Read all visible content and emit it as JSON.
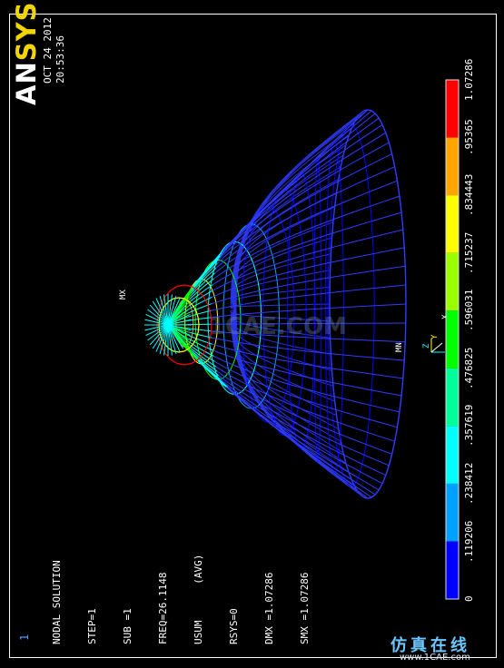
{
  "window": {
    "view_number": "1"
  },
  "logo": {
    "part1": "AN",
    "part2": "SYS"
  },
  "date": "OCT 24 2012",
  "time": "20:53:36",
  "solution_info": [
    "NODAL SOLUTION",
    "STEP=1",
    "SUB =1",
    "FREQ=26.1148",
    "USUM      (AVG)",
    "RSYS=0",
    "DMX =1.07286",
    "SMX =1.07286"
  ],
  "markers": {
    "max": "MX",
    "min": "MN",
    "axis_y": "Y",
    "axis_z": "Z",
    "axis_x": "X"
  },
  "legend": {
    "values": [
      "0",
      ".119206",
      ".238412",
      ".357619",
      ".476825",
      ".596031",
      ".715237",
      ".834443",
      ".95365",
      "1.07286"
    ],
    "colors": [
      "#0000ff",
      "#00a0ff",
      "#00ffff",
      "#00ff9a",
      "#00ff00",
      "#9aff00",
      "#ffff00",
      "#ffa500",
      "#ff0000"
    ]
  },
  "watermark": "1CAE.COM",
  "site_badge": "仿真在线",
  "site_url": "www.1CAE.com"
}
